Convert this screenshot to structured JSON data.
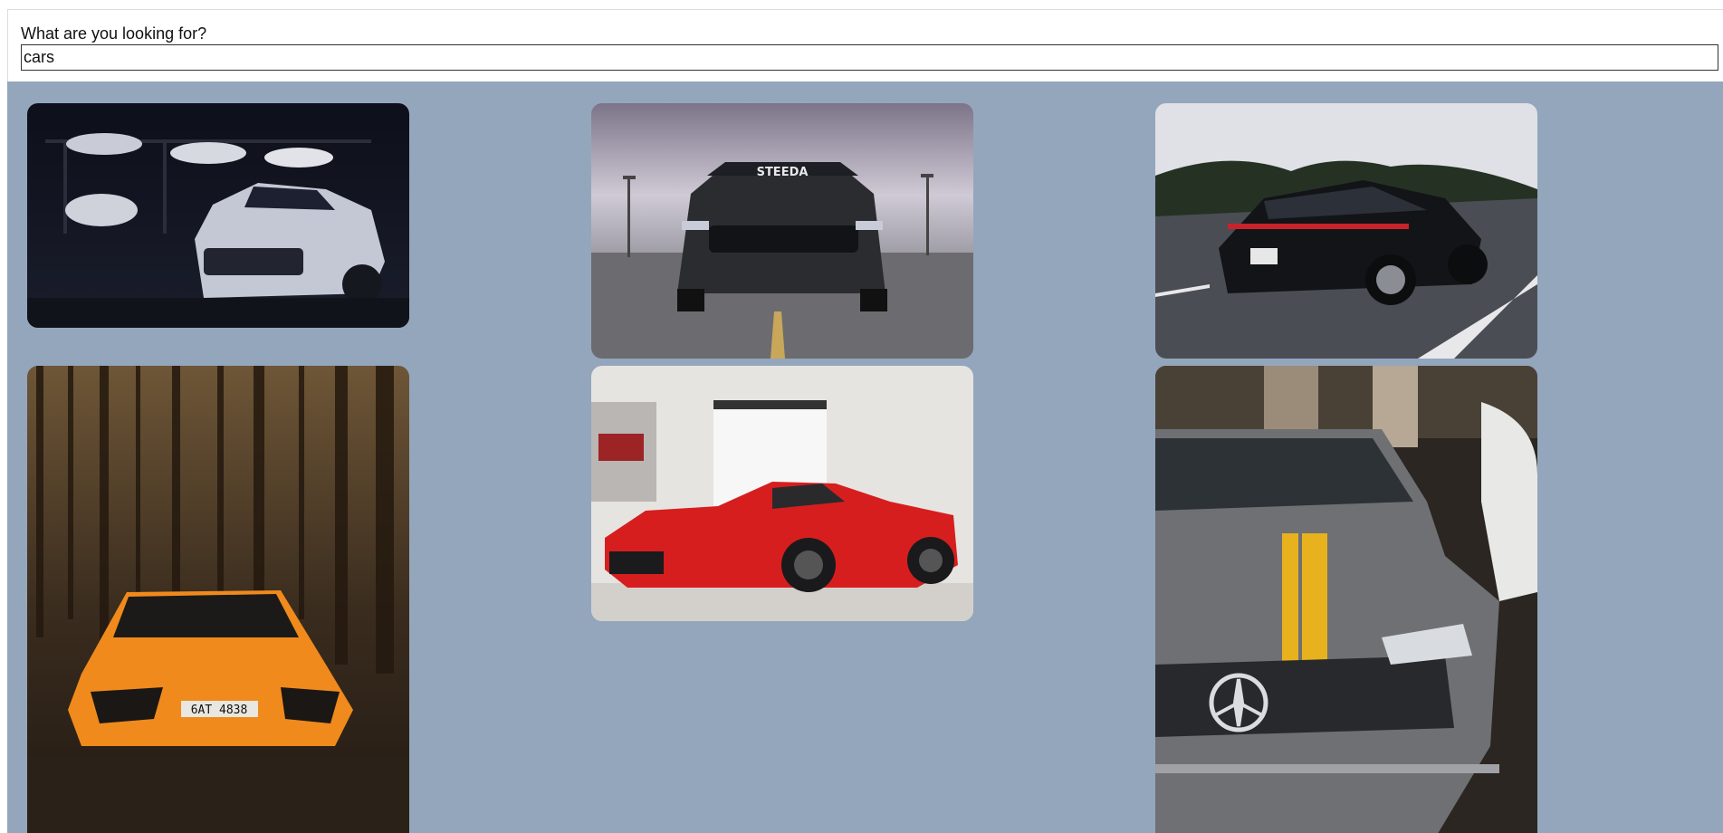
{
  "search": {
    "label": "What are you looking for?",
    "value": "cars"
  },
  "gallery": {
    "images": [
      {
        "subject": "White sports coupe in dark garage with cars on lifts"
      },
      {
        "subject": "Black muscle car front view on parking deck, windshield banner STEEDA"
      },
      {
        "subject": "Black sedan driving on highway, rear three-quarter view"
      },
      {
        "subject": "Orange supercar in forest, plate 6AT 4838"
      },
      {
        "subject": "Red hypercar in white showroom"
      },
      {
        "subject": "Grey sedan front with yellow stripe and three-pointed star emblem"
      }
    ],
    "banner_text": "STEEDA",
    "plate_text": "6AT 4838"
  },
  "colors": {
    "gallery_bg": "#94a6bc",
    "page_bg": "#ffffff"
  }
}
